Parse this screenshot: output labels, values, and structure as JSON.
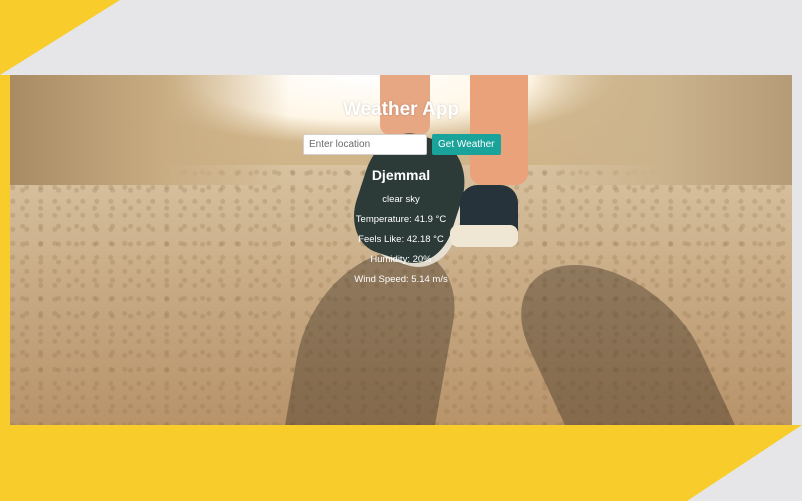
{
  "app": {
    "title": "Weather App",
    "search": {
      "placeholder": "Enter location",
      "value": "",
      "button_label": "Get Weather"
    },
    "result": {
      "city": "Djemmal",
      "description": "clear sky",
      "temperature": "Temperature: 41.9 °C",
      "feels_like": "Feels Like: 42.18 °C",
      "humidity": "Humidity: 20%",
      "wind_speed": "Wind Speed: 5.14 m/s"
    }
  },
  "colors": {
    "accent_yellow": "#f8cd2b",
    "button_teal": "#1aa39a",
    "frame_gray": "#e6e6e8"
  }
}
